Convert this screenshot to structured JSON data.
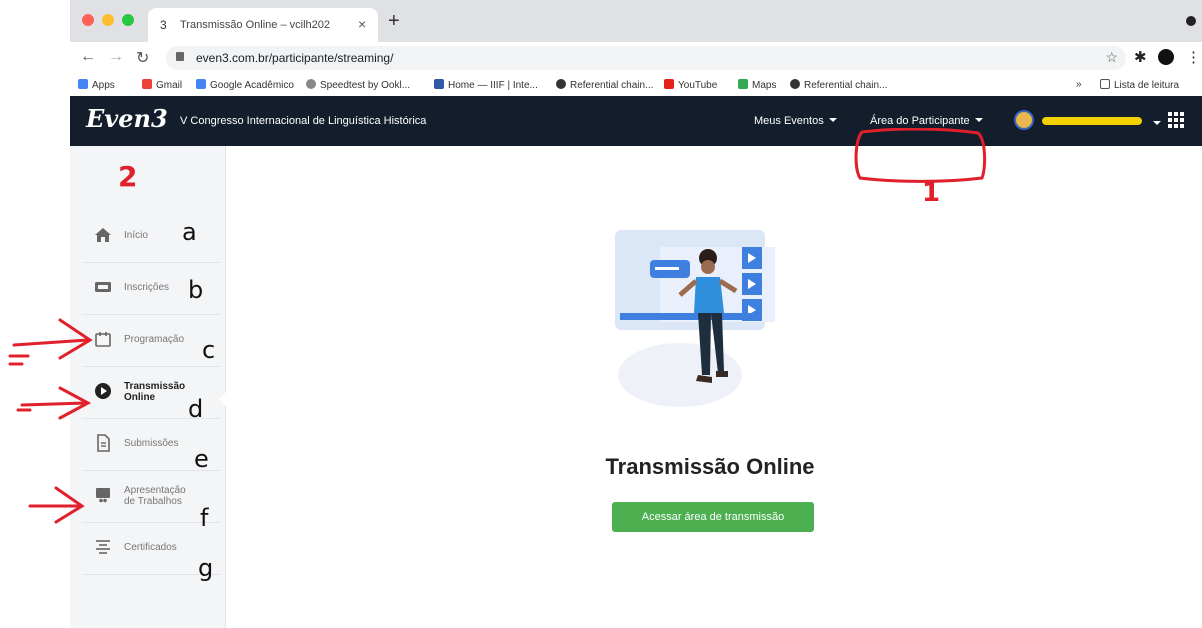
{
  "browser": {
    "tab_number": "3",
    "tab_title": "Transmissão Online – vcilh202",
    "url": "even3.com.br/participante/streaming/",
    "bookmarks": [
      "Apps",
      "Gmail",
      "Google Acadêmico",
      "Speedtest by Ookl...",
      "Home — IIIF | Inte...",
      "Referential chain...",
      "YouTube",
      "Maps",
      "Referential chain..."
    ],
    "reading_list": "Lista de leitura",
    "more": "»"
  },
  "header": {
    "logo": "Even3",
    "event_title": "V Congresso Internacional de Linguística Histórica",
    "menu_events": "Meus Eventos",
    "menu_participant": "Área do Participante"
  },
  "sidebar": {
    "items": [
      {
        "label": "Início",
        "icon": "home-icon"
      },
      {
        "label": "Inscrições",
        "icon": "ticket-icon"
      },
      {
        "label": "Programação",
        "icon": "calendar-icon"
      },
      {
        "label": "Transmissão Online",
        "icon": "play-circle-icon",
        "active": true
      },
      {
        "label": "Submissões",
        "icon": "document-icon"
      },
      {
        "label": "Apresentação de Trabalhos",
        "icon": "presentation-icon"
      },
      {
        "label": "Certificados",
        "icon": "certificate-icon"
      }
    ]
  },
  "main": {
    "title": "Transmissão Online",
    "button": "Acessar área de transmissão"
  },
  "annotations": {
    "num1": "1",
    "num2": "2",
    "letters": [
      "a",
      "b",
      "c",
      "d",
      "e",
      "f",
      "g"
    ]
  },
  "colors": {
    "header_bg": "#131d2b",
    "button_green": "#4caf50",
    "annotation_red": "#e0202a"
  }
}
